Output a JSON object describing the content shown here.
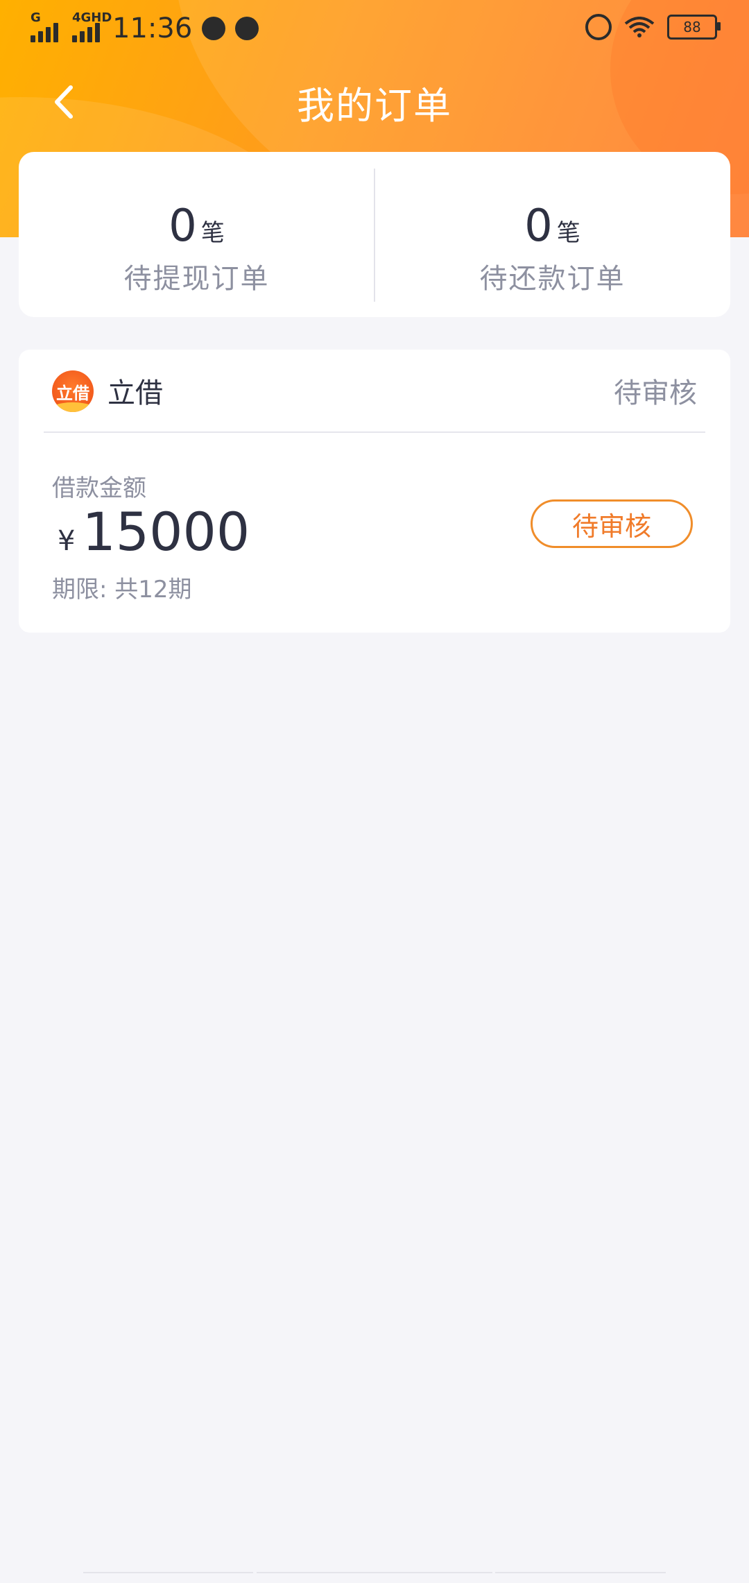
{
  "status_bar": {
    "network_1": "G",
    "network_2": "4GHD",
    "time": "11:36",
    "battery": "88"
  },
  "nav": {
    "title": "我的订单"
  },
  "summary": {
    "items": [
      {
        "count": "0",
        "unit": "笔",
        "label": "待提现订单"
      },
      {
        "count": "0",
        "unit": "笔",
        "label": "待还款订单"
      }
    ]
  },
  "order": {
    "brand_logo_text": "立借",
    "brand_name": "立借",
    "status_text": "待审核",
    "amount_label": "借款金额",
    "currency": "¥",
    "amount": "15000",
    "term": "期限: 共12期",
    "action_label": "待审核"
  },
  "colors": {
    "accent": "#ff8a1e",
    "status_orange": "#f07b2a",
    "background": "#f5f5f9"
  }
}
